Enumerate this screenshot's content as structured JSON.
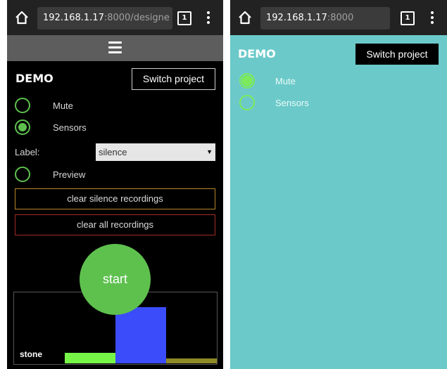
{
  "left": {
    "browser": {
      "url_host": "192.168.1.17",
      "url_rest": ":8000/designe",
      "tab_count": "1"
    },
    "project_title": "DEMO",
    "switch_project_label": "Switch project",
    "options": [
      {
        "label": "Mute",
        "selected": false
      },
      {
        "label": "Sensors",
        "selected": true
      },
      {
        "label": "Preview",
        "selected": false
      }
    ],
    "label_field": {
      "label": "Label:",
      "value": "silence"
    },
    "clear_silence_label": "clear silence recordings",
    "clear_all_label": "clear all recordings",
    "start_label": "start",
    "canvas_label": "stone",
    "colors": {
      "green": "#5ec14e",
      "orange_border": "#b8872a",
      "red_border": "#a12b24",
      "bar_blue": "#3b4cfa",
      "bar_lime": "#76f447",
      "bar_olive": "#8f8a26"
    }
  },
  "right": {
    "browser": {
      "url_host": "192.168.1.17",
      "url_rest": ":8000",
      "tab_count": "1"
    },
    "project_title": "DEMO",
    "switch_project_label": "Switch project",
    "options": [
      {
        "label": "Mute",
        "selected": true
      },
      {
        "label": "Sensors",
        "selected": false
      }
    ],
    "colors": {
      "background": "#6cc9c9",
      "green": "#7cea5c"
    }
  }
}
